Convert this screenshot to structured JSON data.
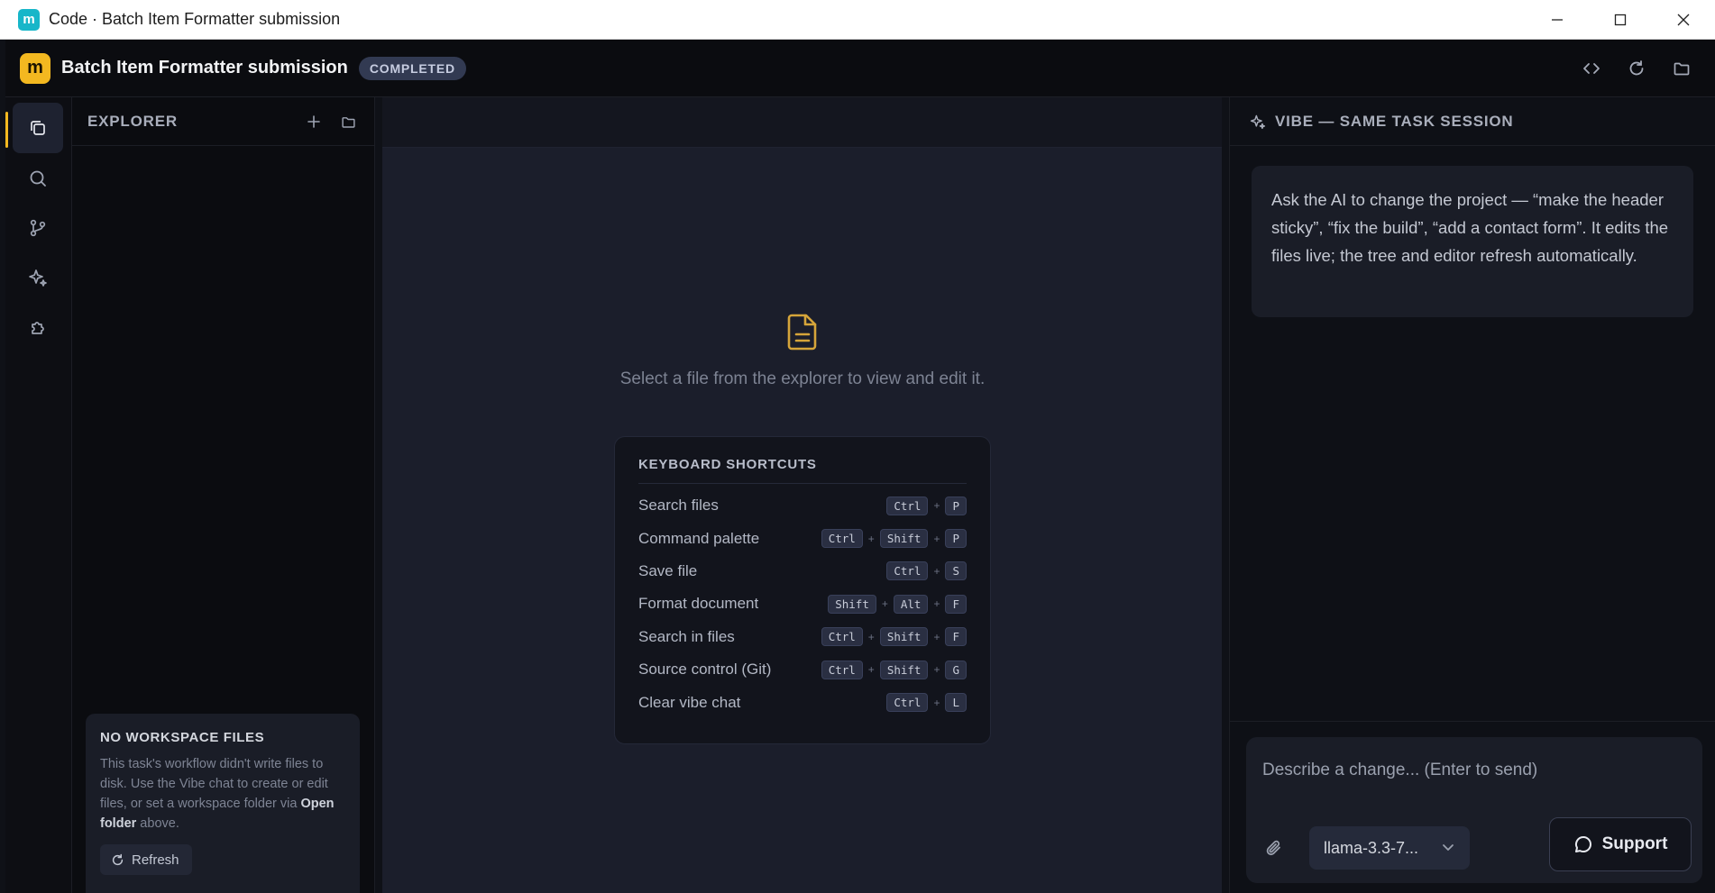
{
  "window": {
    "title": "Code · Batch Item Formatter submission"
  },
  "header": {
    "project_title": "Batch Item Formatter submission",
    "status_badge": "COMPLETED"
  },
  "explorer": {
    "title": "EXPLORER",
    "empty_state": {
      "title": "NO WORKSPACE FILES",
      "text_before": "This task's workflow didn't write files to disk. Use the Vibe chat to create or edit files, or set a workspace folder via ",
      "text_bold": "Open folder",
      "text_after": " above.",
      "refresh_label": "Refresh"
    }
  },
  "editor": {
    "empty_message": "Select a file from the explorer to view and edit it.",
    "shortcuts": {
      "title": "KEYBOARD SHORTCUTS",
      "items": [
        {
          "label": "Search files",
          "keys": [
            "Ctrl",
            "P"
          ]
        },
        {
          "label": "Command palette",
          "keys": [
            "Ctrl",
            "Shift",
            "P"
          ]
        },
        {
          "label": "Save file",
          "keys": [
            "Ctrl",
            "S"
          ]
        },
        {
          "label": "Format document",
          "keys": [
            "Shift",
            "Alt",
            "F"
          ]
        },
        {
          "label": "Search in files",
          "keys": [
            "Ctrl",
            "Shift",
            "F"
          ]
        },
        {
          "label": "Source control (Git)",
          "keys": [
            "Ctrl",
            "Shift",
            "G"
          ]
        },
        {
          "label": "Clear vibe chat",
          "keys": [
            "Ctrl",
            "L"
          ]
        }
      ]
    }
  },
  "vibe": {
    "title": "VIBE — SAME TASK SESSION",
    "intro_message": "Ask the AI to change the project — “make the header sticky”, “fix the build”, “add a contact form”. It edits the files live; the tree and editor refresh automatically.",
    "input_placeholder": "Describe a change... (Enter to send)",
    "model_label": "llama-3.3-7...",
    "support_label": "Support"
  },
  "colors": {
    "accent": "#f3b820",
    "badge_bg": "#323a52",
    "file_icon": "#d6a53a"
  }
}
